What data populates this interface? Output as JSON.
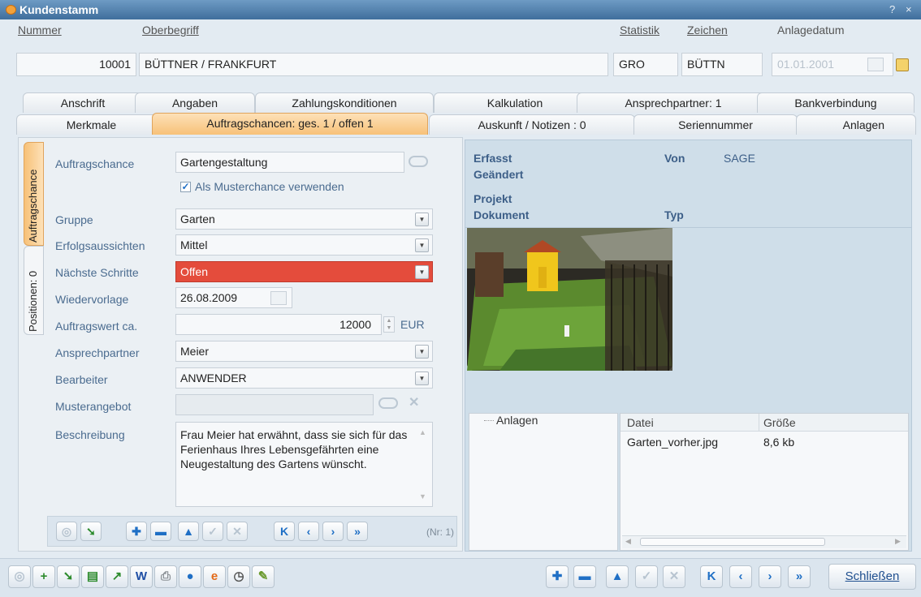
{
  "window": {
    "title": "Kundenstamm",
    "help": "?",
    "close": "×"
  },
  "header": {
    "nummer_label": "Nummer",
    "nummer_value": "10001",
    "oberbegriff_label": "Oberbegriff",
    "oberbegriff_value": "BÜTTNER / FRANKFURT",
    "statistik_label": "Statistik",
    "statistik_value": "GRO",
    "zeichen_label": "Zeichen",
    "zeichen_value": "BÜTTN",
    "anlagedatum_label": "Anlagedatum",
    "anlagedatum_value": "01.01.2001"
  },
  "tabs_row1": [
    "Anschrift",
    "Angaben",
    "Zahlungskonditionen",
    "Kalkulation",
    "Ansprechpartner: 1",
    "Bankverbindung"
  ],
  "tabs_row2": [
    "Merkmale",
    "Auftragschancen: ges. 1 / offen 1",
    "Auskunft / Notizen : 0",
    "Seriennummer",
    "Anlagen"
  ],
  "side_tabs": [
    "Auftragschance",
    "Positionen: 0"
  ],
  "form": {
    "auftragschance_label": "Auftragschance",
    "auftragschance_value": "Gartengestaltung",
    "muster_label": "Als Musterchance verwenden",
    "gruppe_label": "Gruppe",
    "gruppe_value": "Garten",
    "erfolg_label": "Erfolgsaussichten",
    "erfolg_value": "Mittel",
    "schritte_label": "Nächste Schritte",
    "schritte_value": "Offen",
    "wiedervorlage_label": "Wiedervorlage",
    "wiedervorlage_value": "26.08.2009",
    "wert_label": "Auftragswert ca.",
    "wert_value": "12000",
    "wert_currency": "EUR",
    "ansprechpartner_label": "Ansprechpartner",
    "ansprechpartner_value": "Meier",
    "bearbeiter_label": "Bearbeiter",
    "bearbeiter_value": "ANWENDER",
    "musterangebot_label": "Musterangebot",
    "musterangebot_value": "",
    "beschreibung_label": "Beschreibung",
    "beschreibung_value": "Frau Meier hat erwähnt, dass sie sich für das Ferienhaus Ihres Lebensgefährten eine Neugestaltung des Gartens wünscht."
  },
  "record_nr": "(Nr: 1)",
  "info": {
    "erfasst": "Erfasst",
    "von": "Von",
    "von_value": "SAGE",
    "geaendert": "Geändert",
    "projekt": "Projekt",
    "dokument": "Dokument",
    "typ": "Typ"
  },
  "attachments": {
    "tree_label": "Anlagen",
    "columns": [
      "Datei",
      "Größe"
    ],
    "rows": [
      {
        "datei": "Garten_vorher.jpg",
        "groesse": "8,6 kb"
      }
    ]
  },
  "close_button": "Schließen",
  "colors": {
    "accent_tab": "#f7c178",
    "red_field": "#e44c3c",
    "title_bar": "#4f7fae"
  }
}
